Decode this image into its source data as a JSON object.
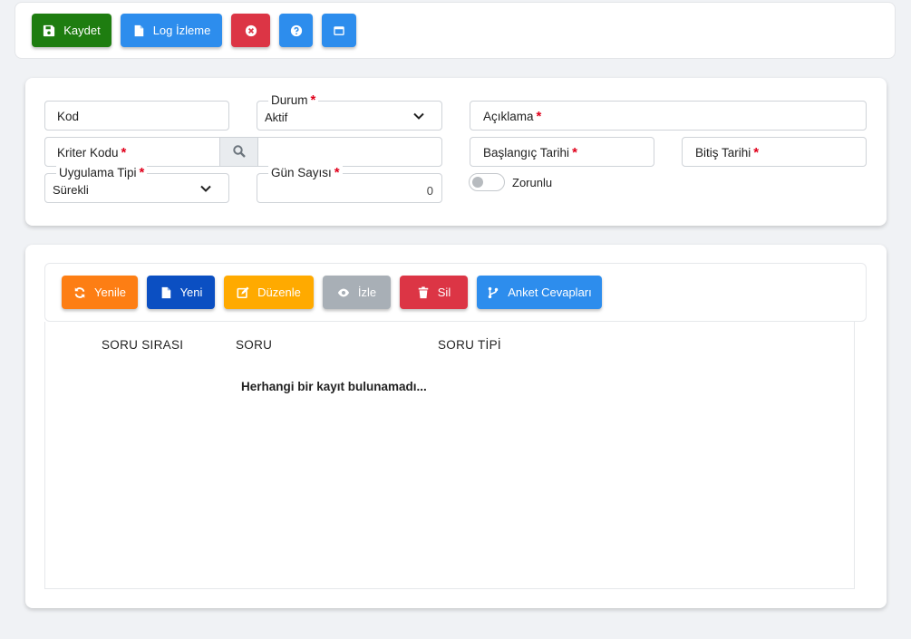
{
  "toolbar": {
    "save_label": "Kaydet",
    "log_label": "Log İzleme"
  },
  "form": {
    "kod_label": "Kod",
    "durum_label": "Durum",
    "durum_value": "Aktif",
    "aciklama_label": "Açıklama",
    "kriter_label": "Kriter Kodu",
    "baslangic_label": "Başlangıç Tarihi",
    "bitis_label": "Bitiş Tarihi",
    "uygulama_label": "Uygulama Tipi",
    "uygulama_value": "Sürekli",
    "gun_label": "Gün Sayısı",
    "gun_value": "0",
    "zorunlu_label": "Zorunlu",
    "required_mark": "*"
  },
  "grid_toolbar": {
    "yenile": "Yenile",
    "yeni": "Yeni",
    "duzenle": "Düzenle",
    "izle": "İzle",
    "sil": "Sil",
    "anket": "Anket Cevapları"
  },
  "grid": {
    "columns": [
      "SORU SIRASI",
      "SORU",
      "SORU TİPİ"
    ],
    "empty_message": "Herhangi bir kayıt bulunamadı..."
  },
  "colors": {
    "save": "#1e7d10",
    "primary": "#2d8ded",
    "danger": "#dc3545",
    "orange": "#fd7e14",
    "navy": "#0b4fc2",
    "warning": "#ffaa00",
    "disabled": "#a8afb6"
  }
}
